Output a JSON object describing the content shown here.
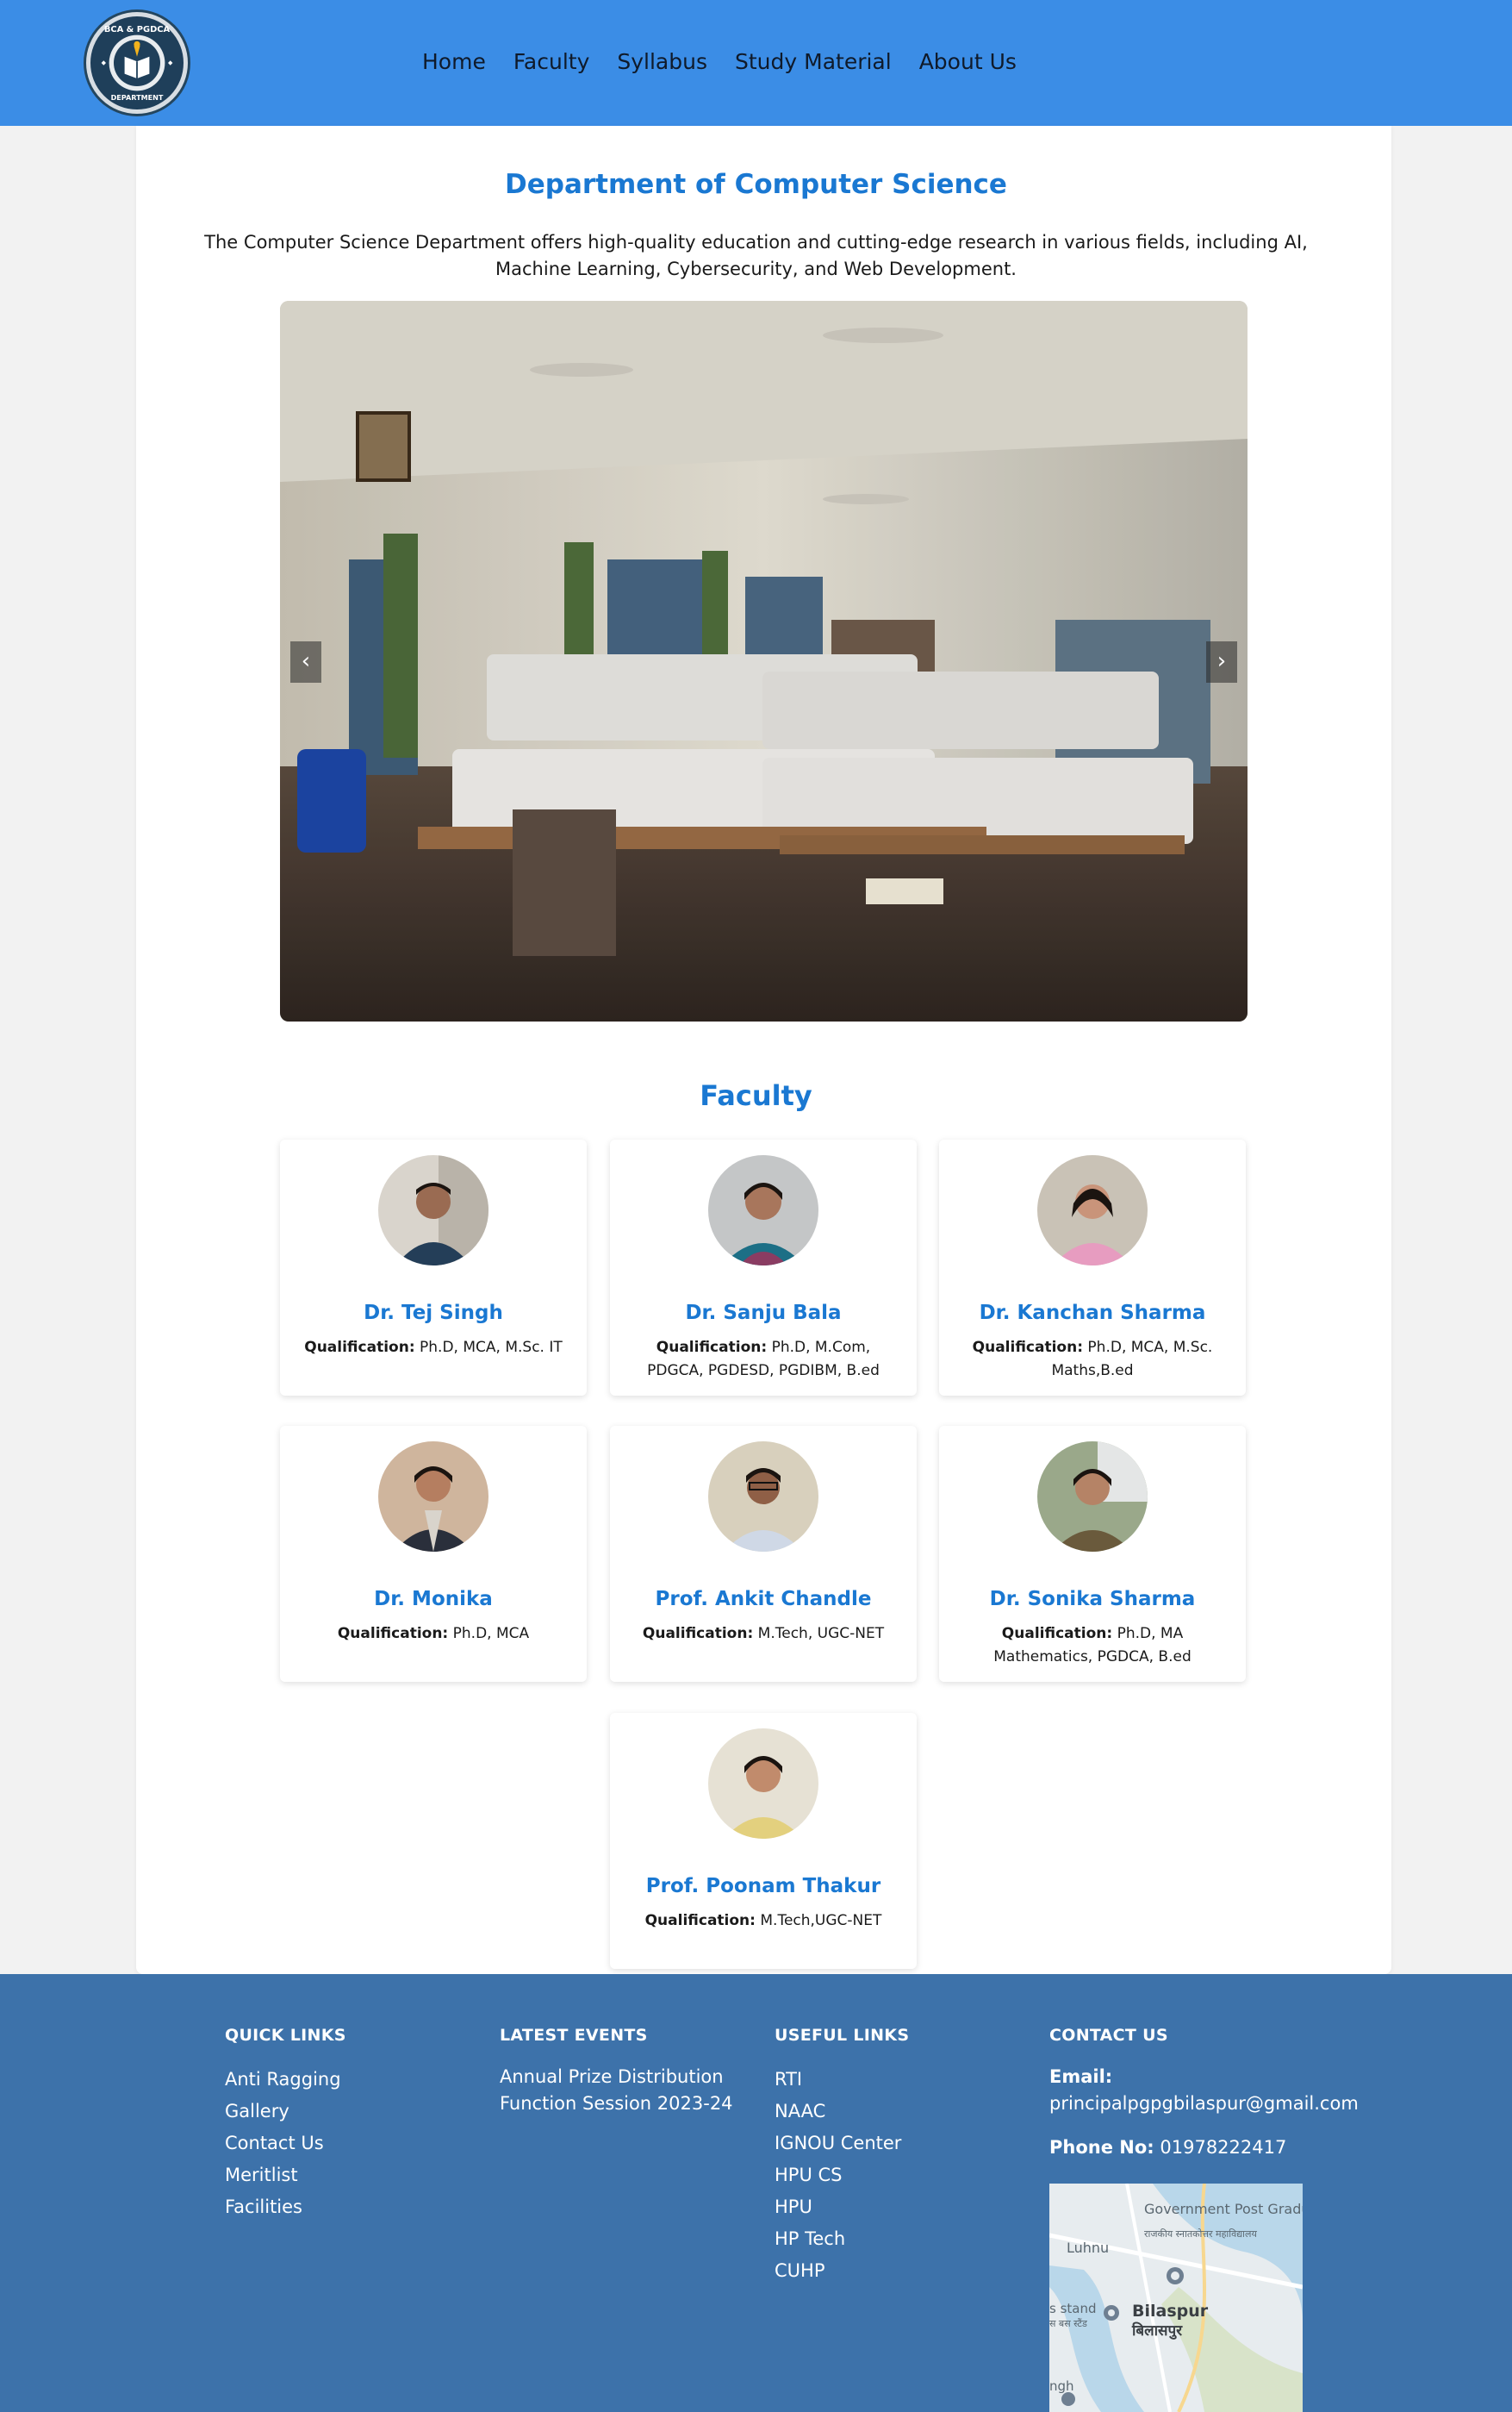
{
  "header": {
    "logo_text": "BCA & PGDCA DEPARTMENT",
    "nav": [
      "Home",
      "Faculty",
      "Syllabus",
      "Study Material",
      "About Us"
    ]
  },
  "main": {
    "title": "Department of Computer Science",
    "intro": "The Computer Science Department offers high-quality education and cutting-edge research in various fields, including AI, Machine Learning, Cybersecurity, and Web Development.",
    "carousel": {
      "prev": "‹",
      "next": "›"
    }
  },
  "faculty": {
    "title": "Faculty",
    "qual_label": "Qualification:",
    "members": [
      {
        "name": "Dr. Tej Singh",
        "qualification": "Ph.D, MCA, M.Sc. IT"
      },
      {
        "name": "Dr. Sanju Bala",
        "qualification": "Ph.D, M.Com, PDGCA, PGDESD, PGDIBM, B.ed"
      },
      {
        "name": "Dr. Kanchan Sharma",
        "qualification": "Ph.D, MCA, M.Sc. Maths,B.ed"
      },
      {
        "name": "Dr. Monika",
        "qualification": "Ph.D, MCA"
      },
      {
        "name": "Prof. Ankit Chandle",
        "qualification": "M.Tech, UGC-NET"
      },
      {
        "name": "Dr. Sonika Sharma",
        "qualification": "Ph.D, MA Mathematics, PGDCA, B.ed"
      },
      {
        "name": "Prof. Poonam Thakur",
        "qualification": "M.Tech,UGC-NET"
      }
    ]
  },
  "footer": {
    "quick_links": {
      "title": "QUICK LINKS",
      "items": [
        "Anti Ragging",
        "Gallery",
        "Contact Us",
        "Meritlist",
        "Facilities"
      ]
    },
    "latest_events": {
      "title": "LATEST EVENTS",
      "items": [
        "Annual Prize Distribution Function Session 2023-24"
      ]
    },
    "useful_links": {
      "title": "USEFUL LINKS",
      "items": [
        "RTI",
        "NAAC",
        "IGNOU Center",
        "HPU CS",
        "HPU",
        "HP Tech",
        "CUHP"
      ]
    },
    "contact": {
      "title": "CONTACT US",
      "email_label": "Email:",
      "email": "principalpgpgbilaspur@gmail.com",
      "phone_label": "Phone No:",
      "phone": "01978222417"
    },
    "map": {
      "label_college": "Government Post Graduate College",
      "label_college_hi": "राजकीय स्नातकोत्तर महाविद्यालय",
      "label_luhnu": "Luhnu",
      "label_stand": "s stand",
      "label_stand_hi": "स बस स्टैंड",
      "label_city": "Bilaspur",
      "label_city_hi": "बिलासपुर",
      "label_bottom": "ngh"
    }
  },
  "colors": {
    "header_bg": "#3b8de6",
    "accent": "#1a78d2",
    "footer_bg": "#3d72aa",
    "page_bg": "#f2f2f2"
  }
}
